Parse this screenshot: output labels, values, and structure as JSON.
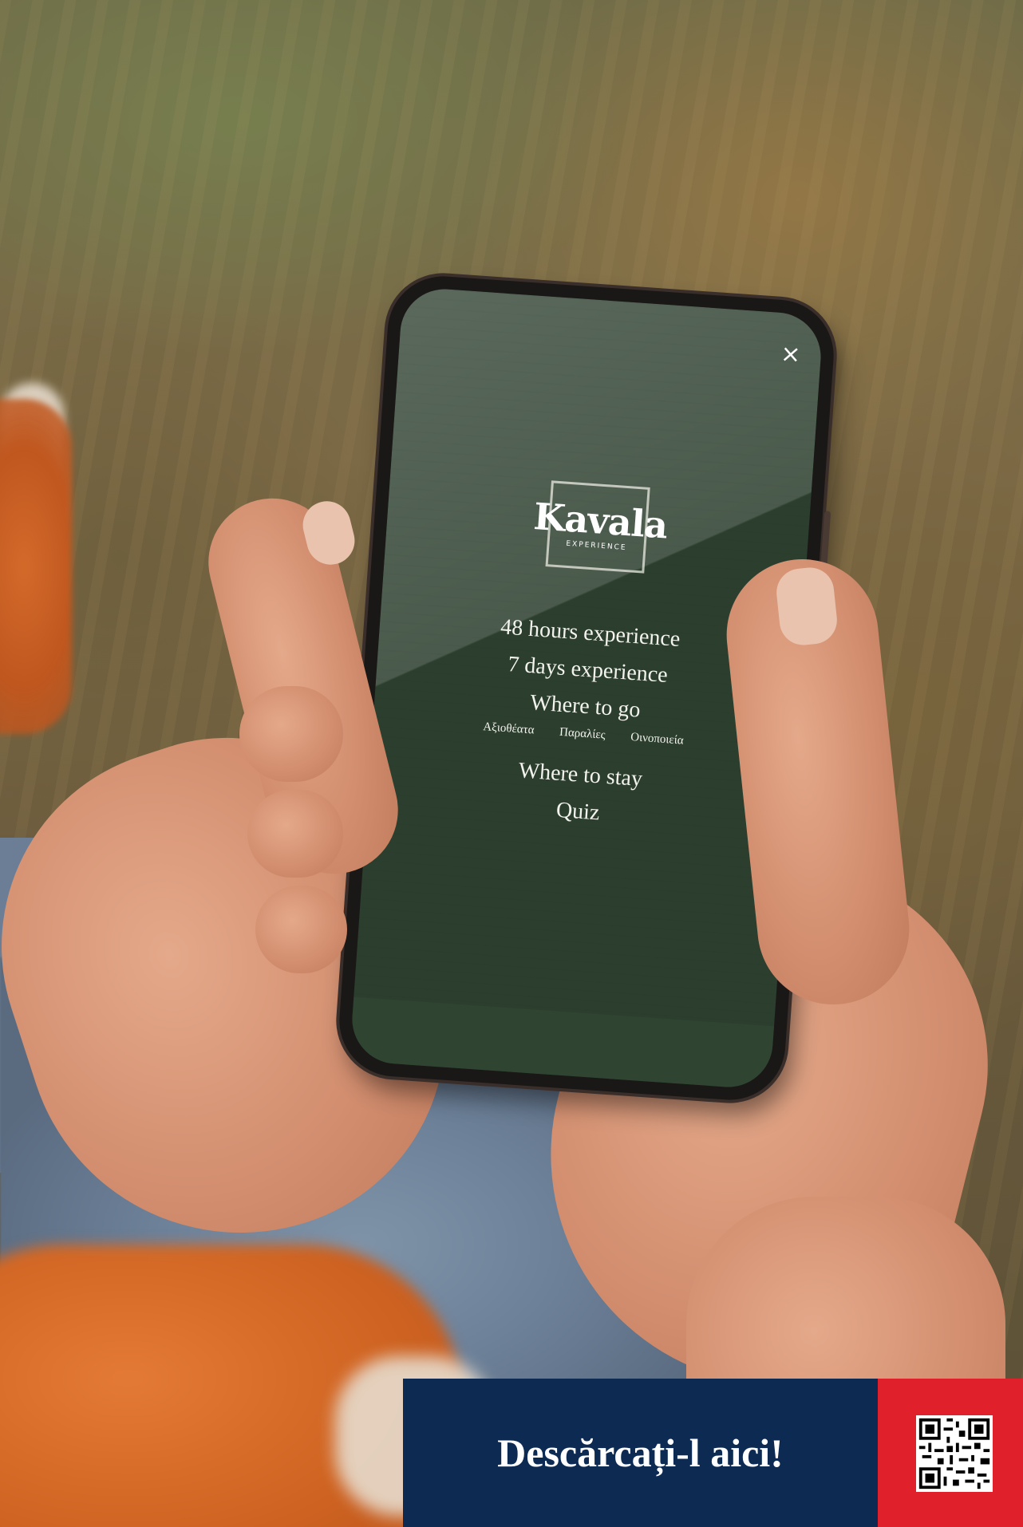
{
  "app": {
    "logo_text": "Kavala",
    "logo_subtitle": "EXPERIENCE",
    "close_label": "×"
  },
  "menu": {
    "items": [
      "48 hours experience",
      "7 days experience",
      "Where to go"
    ],
    "subitems": [
      "Αξιοθέατα",
      "Παραλίες",
      "Οινοποιεία"
    ],
    "items_after": [
      "Where to stay",
      "Quiz"
    ]
  },
  "banner": {
    "cta_text": "Descărcați-l aici!",
    "qr_icon": "qr-code-icon"
  },
  "colors": {
    "screen_green": "#2c3f2e",
    "banner_blue": "#0c2a52",
    "banner_red": "#e0202a"
  }
}
